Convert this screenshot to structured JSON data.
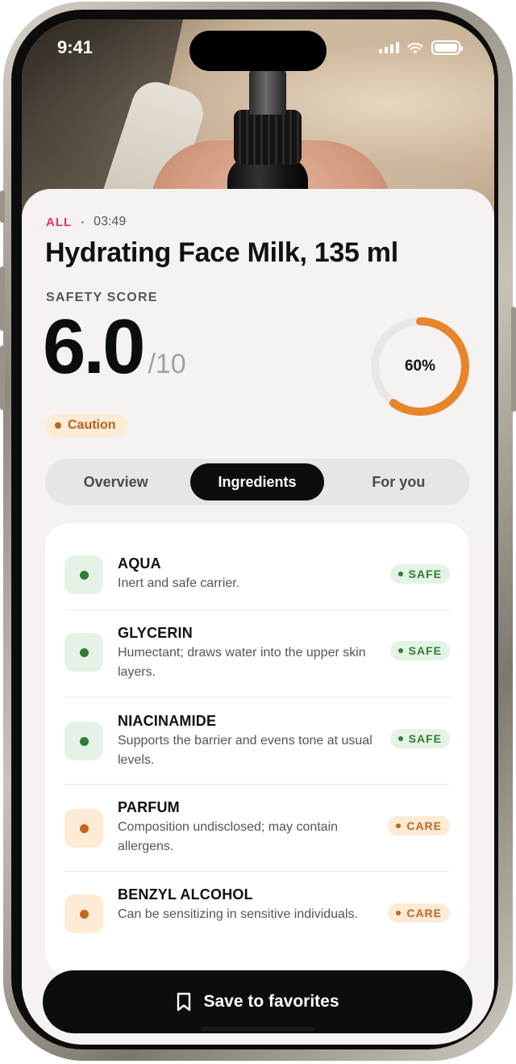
{
  "status_bar": {
    "time": "9:41"
  },
  "product": {
    "tag": "ALL",
    "scan_time": "03:49",
    "title": "Hydrating Face Milk, 135 ml"
  },
  "safety": {
    "label": "SAFETY SCORE",
    "score": "6.0",
    "max": "/10",
    "status": "Caution",
    "percent_label": "60%",
    "percent": 0.6,
    "accent_color": "#e8842a",
    "track_color": "#ebe7e6"
  },
  "tabs": [
    {
      "label": "Overview",
      "active": false
    },
    {
      "label": "Ingredients",
      "active": true
    },
    {
      "label": "For you",
      "active": false
    }
  ],
  "ingredients": [
    {
      "name": "AQUA",
      "description": "Inert and safe carrier.",
      "rating": "SAFE",
      "level": "safe"
    },
    {
      "name": "GLYCERIN",
      "description": "Humectant; draws water into the upper skin layers.",
      "rating": "SAFE",
      "level": "safe"
    },
    {
      "name": "NIACINAMIDE",
      "description": "Supports the barrier and evens tone at usual levels.",
      "rating": "SAFE",
      "level": "safe"
    },
    {
      "name": "PARFUM",
      "description": "Composition undisclosed; may contain allergens.",
      "rating": "CARE",
      "level": "care"
    },
    {
      "name": "BENZYL ALCOHOL",
      "description": "Can be sensitizing in sensitive individuals.",
      "rating": "CARE",
      "level": "care"
    }
  ],
  "colors": {
    "safe": {
      "fg": "#2e7d32",
      "bg": "#e4f3e5"
    },
    "care": {
      "fg": "#c2661f",
      "bg": "#fdebd6"
    },
    "brand_pink": "#e0356c"
  },
  "cta": {
    "label": "Save to favorites",
    "icon": "bookmark-icon"
  }
}
